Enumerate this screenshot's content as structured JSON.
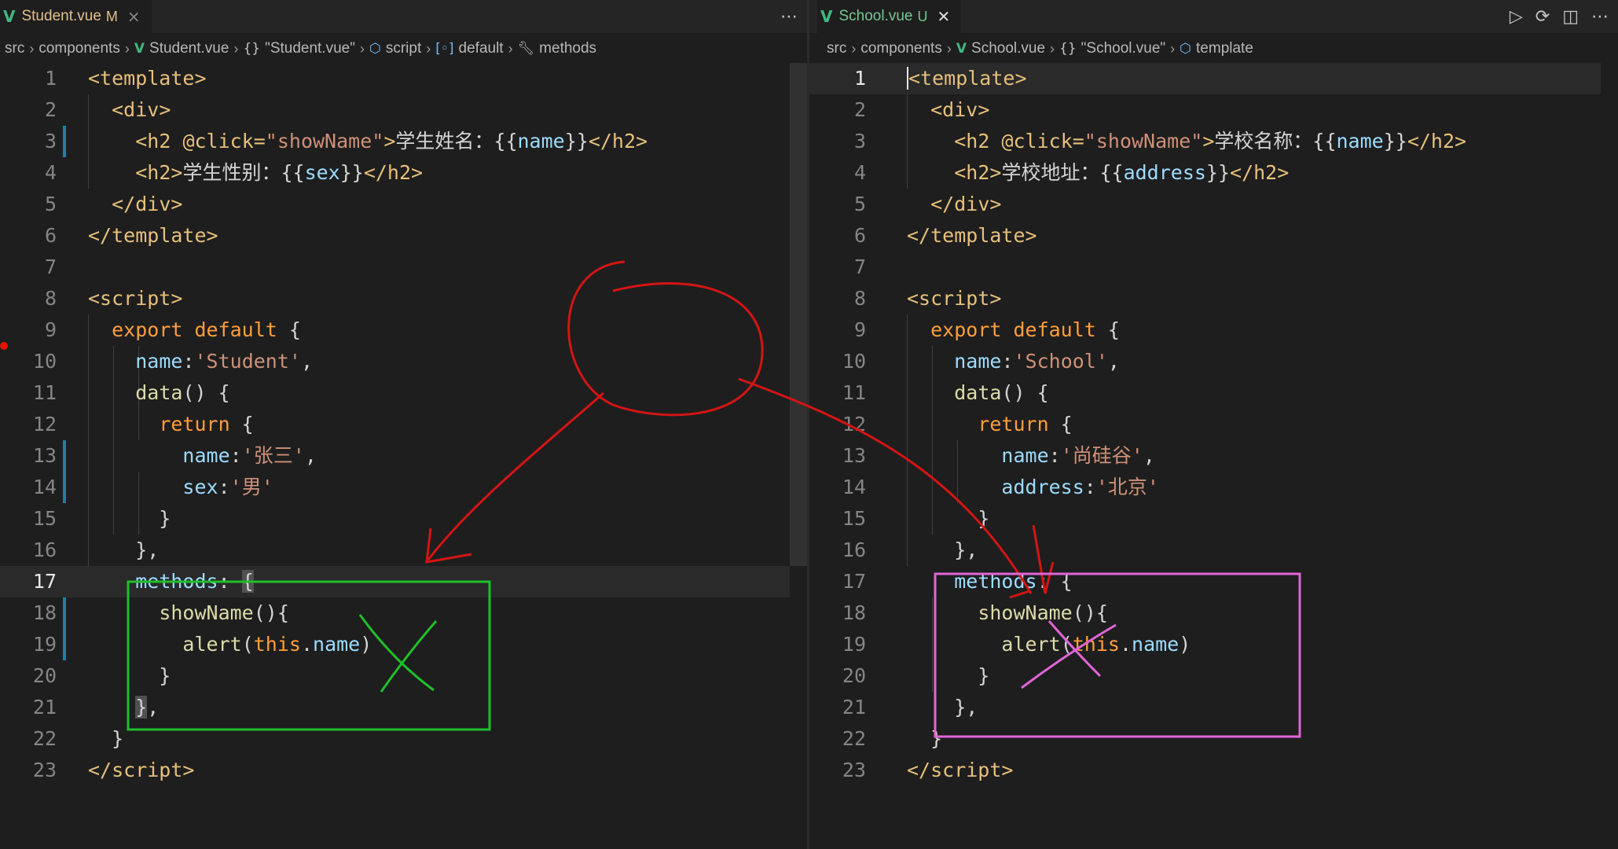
{
  "colors": {
    "background": "#1e1e1e",
    "annotation_red": "#d41414",
    "annotation_green": "#1fbf2a",
    "annotation_pink": "#e066d6"
  },
  "left": {
    "tab": {
      "name": "Student.vue",
      "status": "M",
      "close": "×"
    },
    "tab_actions": [
      "⋯"
    ],
    "breadcrumb": {
      "src": "src",
      "components": "components",
      "file": "Student.vue",
      "object": "\"Student.vue\"",
      "script": "script",
      "default": "default",
      "methods": "methods"
    },
    "active_line": 17
  },
  "right": {
    "tab": {
      "name": "School.vue",
      "status": "U",
      "close": "✕"
    },
    "tab_actions": [
      "▷",
      "⟳",
      "◫",
      "⋯"
    ],
    "breadcrumb": {
      "src": "src",
      "components": "components",
      "file": "School.vue",
      "object": "\"School.vue\"",
      "template": "template"
    },
    "active_line": 1
  }
}
